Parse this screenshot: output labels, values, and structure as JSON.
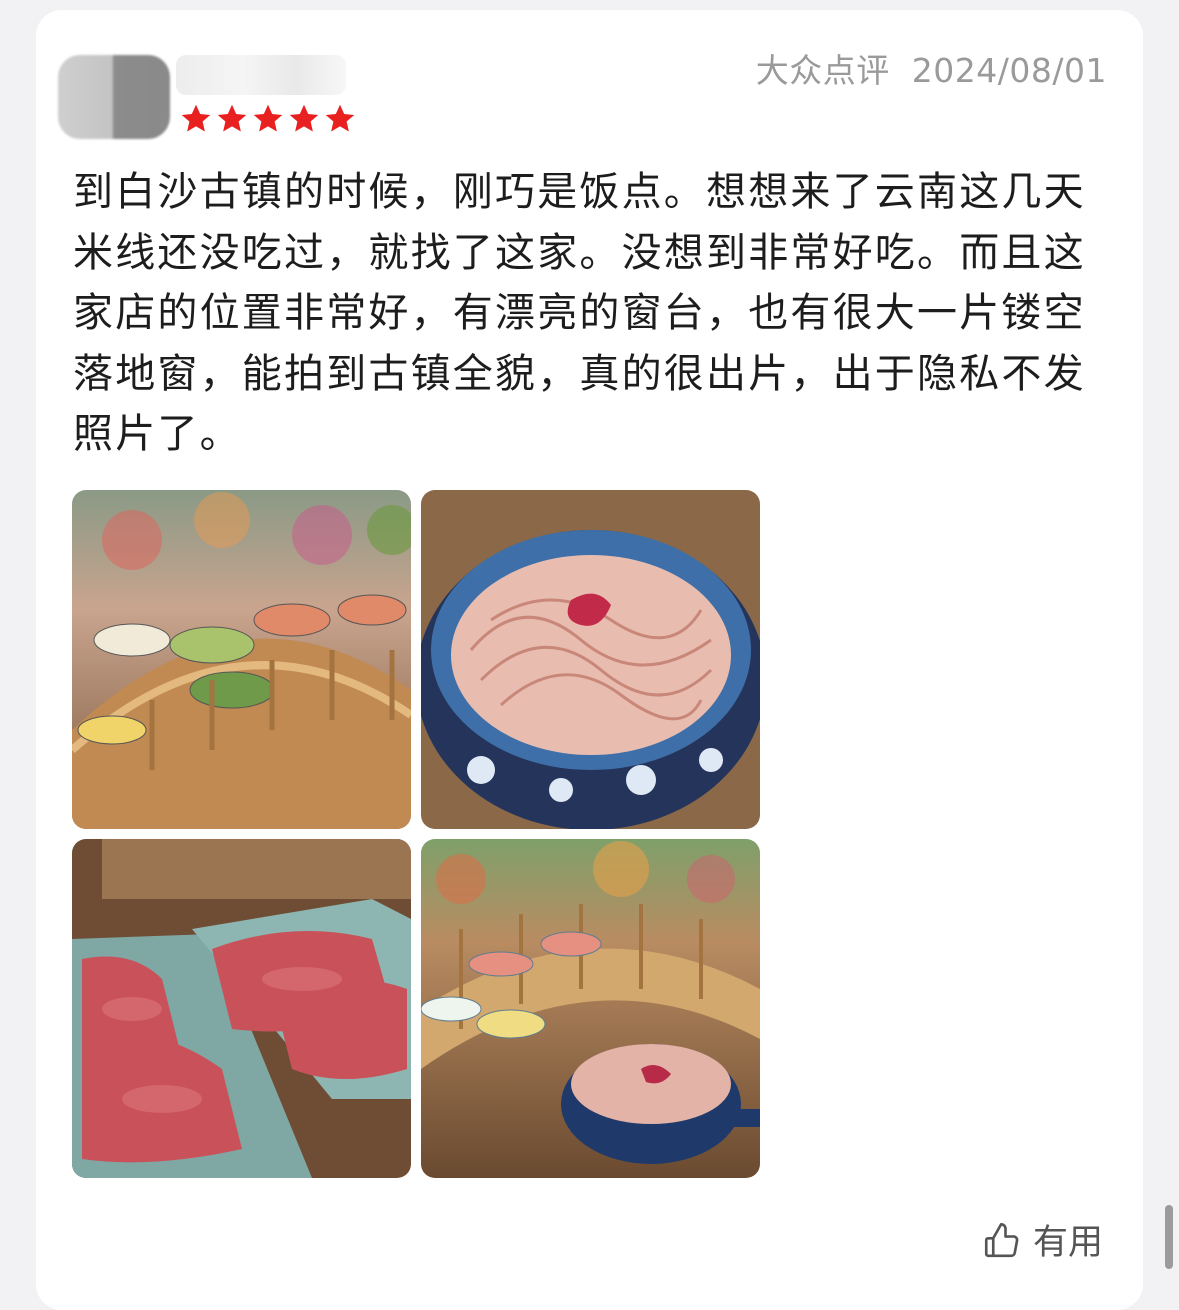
{
  "review": {
    "rating": 5,
    "source": "大众点评",
    "date": "2024/08/01",
    "text": "到白沙古镇的时候，刚巧是饭点。想想来了云南这几天米线还没吃过，就找了这家。没想到非常好吃。而且这家店的位置非常好，有漂亮的窗台，也有很大一片镂空落地窗，能拍到古镇全貌，真的很出片，出于隐私不发照片了。"
  },
  "photos": [
    {
      "icon": "bridge-platter-photo"
    },
    {
      "icon": "rice-noodle-bowl-photo"
    },
    {
      "icon": "sliced-beef-photo"
    },
    {
      "icon": "bridge-and-bowl-photo"
    }
  ],
  "actions": {
    "useful_label": "有用"
  },
  "colors": {
    "star": "#e8201f",
    "meta_text": "#9a9a9a",
    "body_text": "#1d1d1d",
    "background": "#f2f2f4"
  }
}
